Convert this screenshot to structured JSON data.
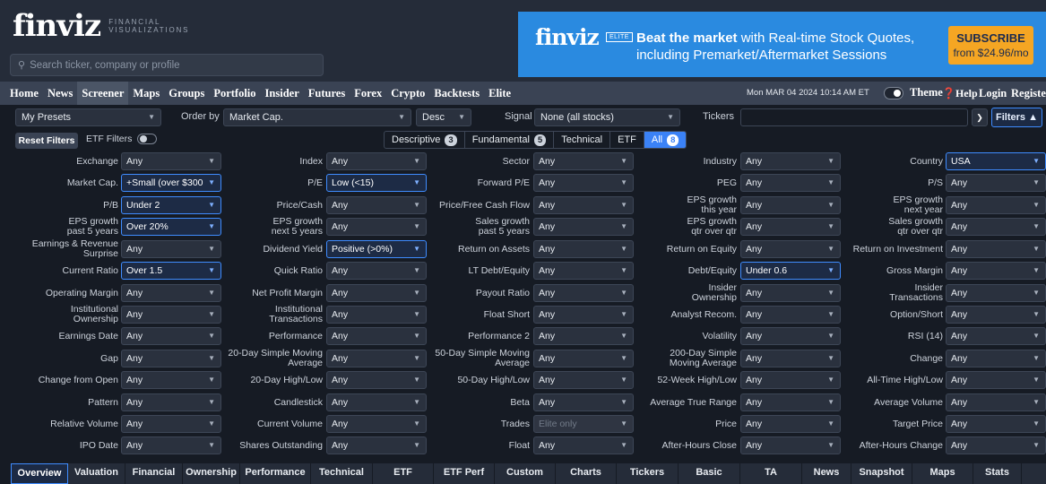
{
  "brand": {
    "wordmark": "finviz",
    "tagline_1": "FINANCIAL",
    "tagline_2": "VISUALIZATIONS"
  },
  "search": {
    "placeholder": "Search ticker, company or profile"
  },
  "ad": {
    "wordmark": "finviz",
    "badge": "ELITE",
    "headline_bold": "Beat the market",
    "headline_rest": " with Real-time Stock Quotes,",
    "line2": "including Premarket/Aftermarket Sessions",
    "cta_top": "SUBSCRIBE",
    "cta_bottom": "from $24.96/mo",
    "bg_color": "#2a8ae0",
    "cta_color": "#f5a623"
  },
  "nav": {
    "items": [
      "Home",
      "News",
      "Screener",
      "Maps",
      "Groups",
      "Portfolio",
      "Insider",
      "Futures",
      "Forex",
      "Crypto",
      "Backtests",
      "Elite"
    ],
    "active": "Screener",
    "datetime": "Mon MAR 04 2024 10:14 AM ET",
    "theme": "Theme",
    "help": "Help",
    "login": "Login",
    "register": "Register"
  },
  "controls": {
    "presets": "My Presets",
    "order_by_label": "Order by",
    "order_by": "Market Cap.",
    "direction": "Desc",
    "signal_label": "Signal",
    "signal": "None (all stocks)",
    "tickers_label": "Tickers",
    "filters_btn": "Filters ▲",
    "reset": "Reset Filters",
    "etf_filters": "ETF Filters"
  },
  "filter_tabs": [
    {
      "label": "Descriptive",
      "count": "3"
    },
    {
      "label": "Fundamental",
      "count": "5"
    },
    {
      "label": "Technical",
      "count": ""
    },
    {
      "label": "ETF",
      "count": ""
    },
    {
      "label": "All",
      "count": "8"
    }
  ],
  "filters": [
    [
      {
        "label": "Exchange",
        "value": "Any"
      },
      {
        "label": "Index",
        "value": "Any"
      },
      {
        "label": "Sector",
        "value": "Any"
      },
      {
        "label": "Industry",
        "value": "Any"
      },
      {
        "label": "Country",
        "value": "USA",
        "selected": true
      }
    ],
    [
      {
        "label": "Market Cap.",
        "value": "+Small (over $300",
        "selected": true
      },
      {
        "label": "P/E",
        "value": "Low (<15)",
        "selected": true
      },
      {
        "label": "Forward P/E",
        "value": "Any"
      },
      {
        "label": "PEG",
        "value": "Any"
      },
      {
        "label": "P/S",
        "value": "Any"
      }
    ],
    [
      {
        "label": "P/B",
        "value": "Under 2",
        "selected": true
      },
      {
        "label": "Price/Cash",
        "value": "Any"
      },
      {
        "label": "Price/Free Cash Flow",
        "value": "Any"
      },
      {
        "label": "EPS growth\nthis year",
        "value": "Any"
      },
      {
        "label": "EPS growth\nnext year",
        "value": "Any"
      }
    ],
    [
      {
        "label": "EPS growth\npast 5 years",
        "value": "Over 20%",
        "selected": true
      },
      {
        "label": "EPS growth\nnext 5 years",
        "value": "Any"
      },
      {
        "label": "Sales growth\npast 5 years",
        "value": "Any"
      },
      {
        "label": "EPS growth\nqtr over qtr",
        "value": "Any"
      },
      {
        "label": "Sales growth\nqtr over qtr",
        "value": "Any"
      }
    ],
    [
      {
        "label": "Earnings & Revenue\nSurprise",
        "value": "Any"
      },
      {
        "label": "Dividend Yield",
        "value": "Positive (>0%)",
        "selected": true
      },
      {
        "label": "Return on Assets",
        "value": "Any"
      },
      {
        "label": "Return on Equity",
        "value": "Any"
      },
      {
        "label": "Return on Investment",
        "value": "Any"
      }
    ],
    [
      {
        "label": "Current Ratio",
        "value": "Over 1.5",
        "selected": true
      },
      {
        "label": "Quick Ratio",
        "value": "Any"
      },
      {
        "label": "LT Debt/Equity",
        "value": "Any"
      },
      {
        "label": "Debt/Equity",
        "value": "Under 0.6",
        "selected": true
      },
      {
        "label": "Gross Margin",
        "value": "Any"
      }
    ],
    [
      {
        "label": "Operating Margin",
        "value": "Any"
      },
      {
        "label": "Net Profit Margin",
        "value": "Any"
      },
      {
        "label": "Payout Ratio",
        "value": "Any"
      },
      {
        "label": "Insider\nOwnership",
        "value": "Any"
      },
      {
        "label": "Insider\nTransactions",
        "value": "Any"
      }
    ],
    [
      {
        "label": "Institutional\nOwnership",
        "value": "Any"
      },
      {
        "label": "Institutional\nTransactions",
        "value": "Any"
      },
      {
        "label": "Float Short",
        "value": "Any"
      },
      {
        "label": "Analyst Recom.",
        "value": "Any"
      },
      {
        "label": "Option/Short",
        "value": "Any"
      }
    ],
    [
      {
        "label": "Earnings Date",
        "value": "Any"
      },
      {
        "label": "Performance",
        "value": "Any"
      },
      {
        "label": "Performance 2",
        "value": "Any"
      },
      {
        "label": "Volatility",
        "value": "Any"
      },
      {
        "label": "RSI (14)",
        "value": "Any"
      }
    ],
    [
      {
        "label": "Gap",
        "value": "Any"
      },
      {
        "label": "20-Day Simple Moving\nAverage",
        "value": "Any"
      },
      {
        "label": "50-Day Simple Moving\nAverage",
        "value": "Any"
      },
      {
        "label": "200-Day Simple\nMoving Average",
        "value": "Any"
      },
      {
        "label": "Change",
        "value": "Any"
      }
    ],
    [
      {
        "label": "Change from Open",
        "value": "Any"
      },
      {
        "label": "20-Day High/Low",
        "value": "Any"
      },
      {
        "label": "50-Day High/Low",
        "value": "Any"
      },
      {
        "label": "52-Week High/Low",
        "value": "Any"
      },
      {
        "label": "All-Time High/Low",
        "value": "Any"
      }
    ],
    [
      {
        "label": "Pattern",
        "value": "Any"
      },
      {
        "label": "Candlestick",
        "value": "Any"
      },
      {
        "label": "Beta",
        "value": "Any"
      },
      {
        "label": "Average True Range",
        "value": "Any"
      },
      {
        "label": "Average Volume",
        "value": "Any"
      }
    ],
    [
      {
        "label": "Relative Volume",
        "value": "Any"
      },
      {
        "label": "Current Volume",
        "value": "Any"
      },
      {
        "label": "Trades",
        "value": "Elite only",
        "disabled": true
      },
      {
        "label": "Price",
        "value": "Any"
      },
      {
        "label": "Target Price",
        "value": "Any"
      }
    ],
    [
      {
        "label": "IPO Date",
        "value": "Any"
      },
      {
        "label": "Shares Outstanding",
        "value": "Any"
      },
      {
        "label": "Float",
        "value": "Any"
      },
      {
        "label": "After-Hours Close",
        "value": "Any"
      },
      {
        "label": "After-Hours Change",
        "value": "Any"
      }
    ]
  ],
  "bottom_tabs": [
    "Overview",
    "Valuation",
    "Financial",
    "Ownership",
    "Performance",
    "Technical",
    "ETF",
    "ETF Perf",
    "Custom",
    "Charts",
    "Tickers",
    "Basic",
    "TA",
    "News",
    "Snapshot",
    "Maps",
    "Stats"
  ],
  "active_bottom_tab": "Overview",
  "colors": {
    "accent": "#3f8cff",
    "page_bg": "#161b24",
    "nav_bg": "#3a4354"
  }
}
